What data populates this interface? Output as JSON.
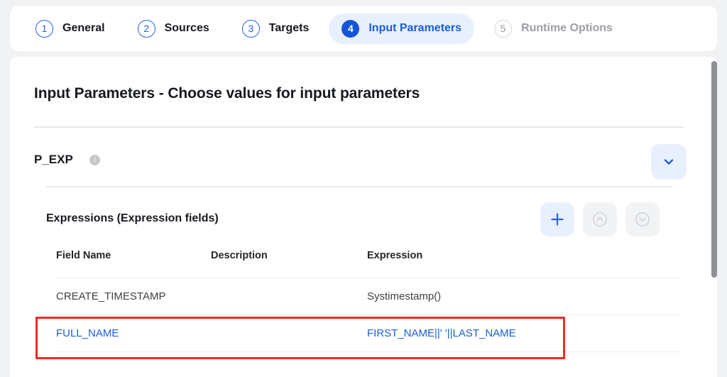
{
  "stepper": {
    "steps": [
      {
        "num": "1",
        "label": "General",
        "state": "todo"
      },
      {
        "num": "2",
        "label": "Sources",
        "state": "todo"
      },
      {
        "num": "3",
        "label": "Targets",
        "state": "todo"
      },
      {
        "num": "4",
        "label": "Input Parameters",
        "state": "active"
      },
      {
        "num": "5",
        "label": "Runtime Options",
        "state": "disabled"
      }
    ]
  },
  "main": {
    "title": "Input Parameters - Choose values for input parameters",
    "parameter": {
      "name": "P_EXP",
      "info_icon": "info-icon",
      "collapse_icon": "chevron-down-icon"
    },
    "expressions": {
      "title": "Expressions (Expression fields)",
      "actions": {
        "add_icon": "plus-icon",
        "move_up_icon": "circle-chevron-up-icon",
        "move_down_icon": "circle-chevron-down-icon"
      },
      "columns": [
        "Field Name",
        "Description",
        "Expression"
      ],
      "rows": [
        {
          "field_name": "CREATE_TIMESTAMP",
          "description": "",
          "expression": "Systimestamp()",
          "linked": false
        },
        {
          "field_name": "FULL_NAME",
          "description": "",
          "expression": "FIRST_NAME||' '||LAST_NAME",
          "linked": true
        }
      ]
    }
  },
  "annotation": {
    "color": "#ee2b24"
  },
  "colors": {
    "accent": "#1a5fd6",
    "accent_fill": "#1355d6",
    "accent_soft": "#e8f0fe",
    "muted": "#9b9ea4",
    "text": "#16191e",
    "annotation": "#ee2b24"
  }
}
